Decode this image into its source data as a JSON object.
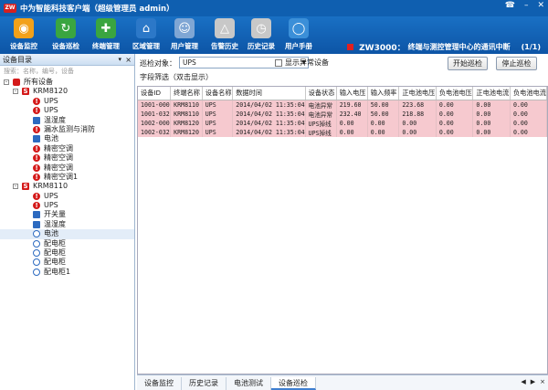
{
  "window": {
    "title": "中为智能科技客户端（超级管理员 admin）",
    "logo_text": "ZW"
  },
  "toolbar": {
    "buttons": [
      {
        "label": "设备监控",
        "icon": "eye-icon"
      },
      {
        "label": "设备巡检",
        "icon": "refresh-icon"
      },
      {
        "label": "终端管理",
        "icon": "terminal-add-icon"
      },
      {
        "label": "区域管理",
        "icon": "building-icon"
      },
      {
        "label": "用户管理",
        "icon": "users-icon"
      },
      {
        "label": "告警历史",
        "icon": "database-alert-icon"
      },
      {
        "label": "历史记录",
        "icon": "database-clock-icon"
      },
      {
        "label": "用户手册",
        "icon": "globe-icon"
      }
    ],
    "alarm_main": "ZW3000：",
    "alarm_text": "终端与测控管理中心的通讯中断",
    "alarm_count": "(1/1)"
  },
  "sidebar": {
    "title": "设备目录",
    "search_placeholder": "搜索：名称，编号，设备",
    "tree": [
      {
        "label": "所有设备",
        "level": 0,
        "icon": "root",
        "toggle": "-"
      },
      {
        "label": "KRM8120",
        "level": 1,
        "icon": "dev",
        "toggle": "-"
      },
      {
        "label": "UPS",
        "level": 2,
        "icon": "alarm-r"
      },
      {
        "label": "UPS",
        "level": 2,
        "icon": "alarm-r"
      },
      {
        "label": "温湿度",
        "level": 2,
        "icon": "ok"
      },
      {
        "label": "漏水监测与消防",
        "level": 2,
        "icon": "alarm-r"
      },
      {
        "label": "电池",
        "level": 2,
        "icon": "ok"
      },
      {
        "label": "精密空调",
        "level": 2,
        "icon": "alarm-r"
      },
      {
        "label": "精密空调",
        "level": 2,
        "icon": "alarm-r"
      },
      {
        "label": "精密空调",
        "level": 2,
        "icon": "alarm-r"
      },
      {
        "label": "精密空调1",
        "level": 2,
        "icon": "alarm-r"
      },
      {
        "label": "KRM8110",
        "level": 1,
        "icon": "dev",
        "toggle": "-"
      },
      {
        "label": "UPS",
        "level": 2,
        "icon": "alarm-r"
      },
      {
        "label": "UPS",
        "level": 2,
        "icon": "alarm-r"
      },
      {
        "label": "开关量",
        "level": 2,
        "icon": "ok"
      },
      {
        "label": "温湿度",
        "level": 2,
        "icon": "ok"
      },
      {
        "label": "电池",
        "level": 2,
        "icon": "pw",
        "selected": true
      },
      {
        "label": "配电柜",
        "level": 2,
        "icon": "pw"
      },
      {
        "label": "配电柜",
        "level": 2,
        "icon": "pw"
      },
      {
        "label": "配电柜",
        "level": 2,
        "icon": "pw"
      },
      {
        "label": "配电柜1",
        "level": 2,
        "icon": "pw"
      }
    ]
  },
  "patrol": {
    "target_label": "巡检对象：",
    "target_value": "UPS",
    "show_abnormal": "显示异常设备",
    "start_button": "开始巡检",
    "stop_button": "停止巡检",
    "filter_label": "字段筛选（双击显示）"
  },
  "table": {
    "columns": [
      "设备ID",
      "终端名称",
      "设备名称",
      "数据时间",
      "设备状态",
      "输入电压",
      "输入频率",
      "正电池电压",
      "负电池电压",
      "正电池电流",
      "负电池电流"
    ],
    "rows": [
      [
        "1001-000",
        "KRM8110",
        "UPS",
        "2014/04/02 11:35:04",
        "电池异常",
        "219.60",
        "50.00",
        "223.68",
        "0.00",
        "0.00",
        "0.00"
      ],
      [
        "1001-032",
        "KRM8110",
        "UPS",
        "2014/04/02 11:35:04",
        "电池异常",
        "232.40",
        "50.00",
        "218.88",
        "0.00",
        "0.00",
        "0.00"
      ],
      [
        "1002-000",
        "KRM8120",
        "UPS",
        "2014/04/02 11:35:04",
        "UPS掉线",
        "0.00",
        "0.00",
        "0.00",
        "0.00",
        "0.00",
        "0.00"
      ],
      [
        "1002-032",
        "KRM8120",
        "UPS",
        "2014/04/02 11:35:04",
        "UPS掉线",
        "0.00",
        "0.00",
        "0.00",
        "0.00",
        "0.00",
        "0.00"
      ]
    ]
  },
  "tabs": [
    "设备监控",
    "历史记录",
    "电池测试",
    "设备巡检"
  ],
  "active_tab": "设备巡检"
}
